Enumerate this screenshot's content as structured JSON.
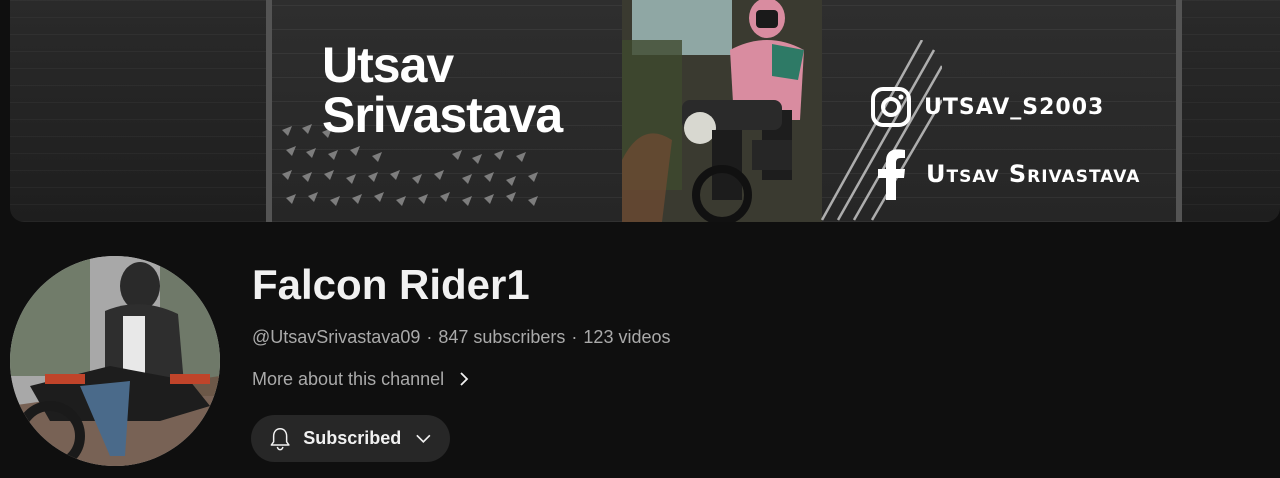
{
  "banner": {
    "name_line1": "Utsav",
    "name_line2": "Srivastava",
    "instagram_handle": "UTSAV_S2003",
    "facebook_name": "Utsav Srivastava",
    "icons": [
      "instagram-icon",
      "facebook-icon"
    ]
  },
  "channel": {
    "title": "Falcon Rider1",
    "handle": "@UtsavSrivastava09",
    "separator": "·",
    "subscribers": "847 subscribers",
    "videos": "123 videos",
    "more_about": "More about this channel",
    "subscribe_state": "Subscribed"
  },
  "colors": {
    "background": "#0f0f0f",
    "title_text": "#f1f1f1",
    "meta_text": "#aaaaaa",
    "button_bg": "#272727"
  }
}
